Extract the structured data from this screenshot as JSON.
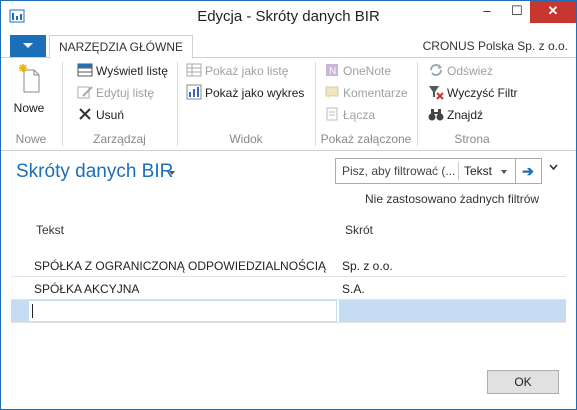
{
  "window": {
    "title": "Edycja - Skróty danych BIR",
    "minimize": "–",
    "maximize": "☐",
    "close": "✕"
  },
  "ribbon_tabs": {
    "home": "NARZĘDZIA GŁÓWNE",
    "company": "CRONUS Polska Sp. z o.o."
  },
  "ribbon": {
    "new_group": {
      "name": "Nowe",
      "new_label": "Nowe"
    },
    "manage_group": {
      "name": "Zarządzaj",
      "show_list": "Wyświetl listę",
      "edit_list": "Edytuj listę",
      "delete": "Usuń"
    },
    "view_group": {
      "name": "Widok",
      "show_as_list": "Pokaż jako listę",
      "show_as_chart": "Pokaż jako wykres"
    },
    "attachments_group": {
      "name": "Pokaż załączone",
      "onenote": "OneNote",
      "comments": "Komentarze",
      "links": "Łącza"
    },
    "page_group": {
      "name": "Strona",
      "refresh": "Odśwież",
      "clear_filter": "Wyczyść Filtr",
      "find": "Znajdź"
    }
  },
  "page": {
    "title": "Skróty danych BIR",
    "filter_placeholder": "Pisz, aby filtrować (...",
    "filter_field": "Tekst",
    "no_filters": "Nie zastosowano żadnych filtrów"
  },
  "table": {
    "headers": [
      "Tekst",
      "Skrót"
    ],
    "rows": [
      [
        "SPÓŁKA Z OGRANICZONĄ ODPOWIEDZIALNOŚCIĄ",
        "Sp. z o.o."
      ],
      [
        "SPÓŁKA AKCYJNA",
        "S.A."
      ]
    ]
  },
  "footer": {
    "ok": "OK"
  },
  "colors": {
    "accent": "#1b6fb8",
    "close": "#c7372f",
    "selected_row": "#c5dcf2"
  }
}
